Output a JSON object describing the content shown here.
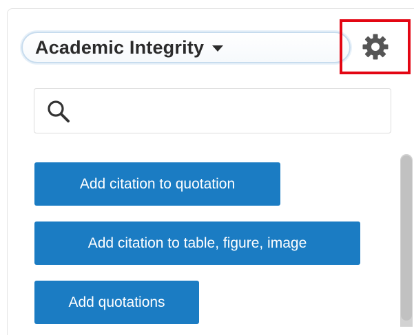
{
  "header": {
    "style_selector": {
      "label": "Academic Integrity",
      "icon": "caret-down-icon"
    },
    "settings": {
      "icon": "gear-icon",
      "highlight_color": "#e30613"
    }
  },
  "search": {
    "icon": "search-icon",
    "value": "",
    "placeholder": ""
  },
  "actions": [
    {
      "label": "Add citation to quotation"
    },
    {
      "label": "Add citation to table, figure, image"
    },
    {
      "label": "Add quotations"
    }
  ],
  "colors": {
    "button_bg": "#1b7cc3",
    "button_text": "#ffffff",
    "text_dark": "#2b2b2b"
  }
}
